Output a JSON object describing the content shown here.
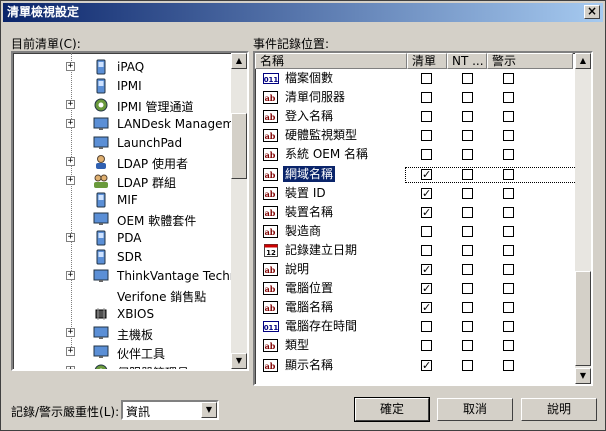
{
  "window": {
    "title": "清單檢視設定",
    "close": "×"
  },
  "left": {
    "label": "目前清單(C):",
    "tree": [
      {
        "label": "iPAQ",
        "icon": "device-icon",
        "expand": true
      },
      {
        "label": "IPMI",
        "icon": "device-icon",
        "expand": false
      },
      {
        "label": "IPMI 管理通道",
        "icon": "gear-icon",
        "expand": true
      },
      {
        "label": "LANDesk Management",
        "icon": "monitor-icon",
        "expand": true
      },
      {
        "label": "LaunchPad",
        "icon": "monitor-icon",
        "expand": false
      },
      {
        "label": "LDAP 使用者",
        "icon": "user-icon",
        "expand": true
      },
      {
        "label": "LDAP 群組",
        "icon": "group-icon",
        "expand": true
      },
      {
        "label": "MIF",
        "icon": "device-icon",
        "expand": false
      },
      {
        "label": "OEM 軟體套件",
        "icon": "monitor-icon",
        "expand": false
      },
      {
        "label": "PDA",
        "icon": "device-icon",
        "expand": true
      },
      {
        "label": "SDR",
        "icon": "device-icon",
        "expand": false
      },
      {
        "label": "ThinkVantage Technologies",
        "icon": "monitor-icon",
        "expand": true
      },
      {
        "label": "Verifone 銷售點",
        "icon": "none",
        "expand": false
      },
      {
        "label": "XBIOS",
        "icon": "chip-icon",
        "expand": false
      },
      {
        "label": "主機板",
        "icon": "monitor-icon",
        "expand": true
      },
      {
        "label": "伙伴工具",
        "icon": "monitor-icon",
        "expand": true
      },
      {
        "label": "伺服器管理員",
        "icon": "gear-icon",
        "expand": true
      }
    ]
  },
  "right": {
    "label": "事件記錄位置:",
    "headers": {
      "name": "名稱",
      "clear": "清單",
      "nt": "NT ...",
      "alert": "警示"
    },
    "rows": [
      {
        "name": "檔案個數",
        "icon": "num-icon",
        "clear": false,
        "nt": false,
        "alert": false
      },
      {
        "name": "清單伺服器",
        "icon": "text-icon",
        "clear": false,
        "nt": false,
        "alert": false
      },
      {
        "name": "登入名稱",
        "icon": "text-icon",
        "clear": false,
        "nt": false,
        "alert": false
      },
      {
        "name": "硬體監視類型",
        "icon": "text-icon",
        "clear": false,
        "nt": false,
        "alert": false
      },
      {
        "name": "系統 OEM 名稱",
        "icon": "text-icon",
        "clear": false,
        "nt": false,
        "alert": false
      },
      {
        "name": "網域名稱",
        "icon": "text-icon",
        "clear": true,
        "nt": false,
        "alert": false,
        "selected": true
      },
      {
        "name": "裝置 ID",
        "icon": "text-icon",
        "clear": true,
        "nt": false,
        "alert": false
      },
      {
        "name": "裝置名稱",
        "icon": "text-icon",
        "clear": true,
        "nt": false,
        "alert": false
      },
      {
        "name": "製造商",
        "icon": "text-icon",
        "clear": false,
        "nt": false,
        "alert": false
      },
      {
        "name": "記錄建立日期",
        "icon": "calendar-icon",
        "clear": false,
        "nt": false,
        "alert": false
      },
      {
        "name": "說明",
        "icon": "text-icon",
        "clear": true,
        "nt": false,
        "alert": false
      },
      {
        "name": "電腦位置",
        "icon": "text-icon",
        "clear": true,
        "nt": false,
        "alert": false
      },
      {
        "name": "電腦名稱",
        "icon": "text-icon",
        "clear": true,
        "nt": false,
        "alert": false
      },
      {
        "name": "電腦存在時間",
        "icon": "num-icon",
        "clear": false,
        "nt": false,
        "alert": false
      },
      {
        "name": "類型",
        "icon": "text-icon",
        "clear": false,
        "nt": false,
        "alert": false
      },
      {
        "name": "顯示名稱",
        "icon": "text-icon",
        "clear": true,
        "nt": false,
        "alert": false
      }
    ]
  },
  "footer": {
    "severity_label": "記錄/警示嚴重性(L):",
    "severity_value": "資訊",
    "ok": "確定",
    "cancel": "取消",
    "help": "說明"
  },
  "icon_glyphs": {
    "num": "011",
    "text": "ab",
    "calendar": "12"
  }
}
